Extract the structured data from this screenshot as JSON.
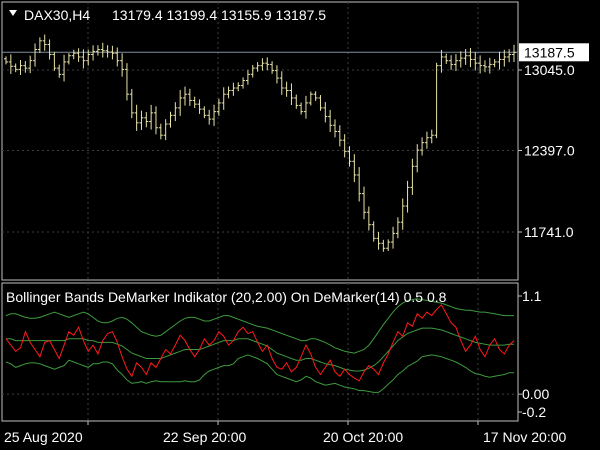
{
  "window": {
    "menu_icon": "triangle-down-icon",
    "symbol": "DAX30,H4",
    "ohlc": "13179.4 13199.4 13155.9 13187.5"
  },
  "main_chart": {
    "price_ticks": [
      {
        "label": "13045.0",
        "value": 13045.0
      },
      {
        "label": "12397.0",
        "value": 12397.0
      },
      {
        "label": "11741.0",
        "value": 11741.0
      }
    ],
    "last_price": {
      "label": "13187.5",
      "value": 13187.5
    },
    "colors": {
      "candle": "#e8e3a8",
      "grid": "#3a3f45",
      "border": "#bfbfbf",
      "price_line": "#7f8fa0"
    }
  },
  "indicator": {
    "title": "Bollinger Bands DeMarker Indikator (20,2.00) On DeMarker(14) 0.5 0.8",
    "ticks": [
      {
        "label": "1.1",
        "value": 1.1
      },
      {
        "label": "0.00",
        "value": 0.0
      },
      {
        "label": "-0.2",
        "value": -0.2
      }
    ],
    "colors": {
      "demarker": "#ff1a1a",
      "bands": "#3d9a3d"
    }
  },
  "time_axis": [
    {
      "label": "25 Aug 2020",
      "index": 0
    },
    {
      "label": "22 Sep 20:00",
      "index": 1
    },
    {
      "label": "20 Oct 20:00",
      "index": 2
    },
    {
      "label": "17 Nov 20:00",
      "index": 3
    }
  ],
  "chart_data": [
    {
      "type": "candlestick",
      "title": "DAX30,H4",
      "y_ticks": [
        13045.0,
        12397.0,
        11741.0
      ],
      "last_value": 13187.5,
      "open": 13179.4,
      "high": 13199.4,
      "low": 13155.9,
      "close": 13187.5,
      "closes": [
        13110,
        13075,
        13050,
        13080,
        13060,
        13120,
        13210,
        13280,
        13250,
        13170,
        13060,
        13010,
        13110,
        13160,
        13180,
        13150,
        13120,
        13170,
        13195,
        13210,
        13200,
        13190,
        13180,
        13120,
        13050,
        12850,
        12700,
        12620,
        12660,
        12630,
        12700,
        12580,
        12520,
        12610,
        12680,
        12740,
        12820,
        12850,
        12800,
        12770,
        12730,
        12680,
        12650,
        12710,
        12780,
        12850,
        12880,
        12900,
        12920,
        12960,
        13010,
        13060,
        13080,
        13100,
        13090,
        13040,
        12980,
        12900,
        12880,
        12820,
        12760,
        12710,
        12780,
        12850,
        12820,
        12740,
        12670,
        12600,
        12550,
        12480,
        12390,
        12310,
        12200,
        12050,
        11900,
        11800,
        11690,
        11650,
        11610,
        11660,
        11730,
        11820,
        11950,
        12100,
        12270,
        12400,
        12460,
        12500,
        12520,
        13080,
        13150,
        13120,
        13090,
        13120,
        13140,
        13160,
        13130,
        13100,
        13080,
        13070,
        13090,
        13110,
        13130,
        13150,
        13170,
        13187.5
      ]
    },
    {
      "type": "line",
      "title": "Bollinger Bands DeMarker Indikator (20,2.00) On DeMarker(14) 0.5 0.8",
      "y_ticks": [
        1.1,
        0.0,
        -0.2
      ],
      "ylim": [
        -0.2,
        1.1
      ],
      "series": [
        {
          "values": [
            0.62,
            0.55,
            0.48,
            0.52,
            0.7,
            0.58,
            0.5,
            0.42,
            0.58,
            0.6,
            0.5,
            0.4,
            0.55,
            0.7,
            0.66,
            0.75,
            0.6,
            0.48,
            0.55,
            0.45,
            0.6,
            0.68,
            0.7,
            0.58,
            0.42,
            0.28,
            0.2,
            0.35,
            0.3,
            0.22,
            0.35,
            0.3,
            0.4,
            0.5,
            0.45,
            0.55,
            0.66,
            0.6,
            0.5,
            0.42,
            0.5,
            0.62,
            0.55,
            0.6,
            0.7,
            0.65,
            0.55,
            0.6,
            0.7,
            0.75,
            0.68,
            0.7,
            0.58,
            0.48,
            0.55,
            0.4,
            0.3,
            0.28,
            0.35,
            0.25,
            0.3,
            0.42,
            0.55,
            0.45,
            0.3,
            0.22,
            0.3,
            0.38,
            0.25,
            0.2,
            0.28,
            0.22,
            0.18,
            0.15,
            0.25,
            0.32,
            0.28,
            0.22,
            0.35,
            0.45,
            0.58,
            0.7,
            0.65,
            0.8,
            0.76,
            0.9,
            0.85,
            0.92,
            0.88,
            0.95,
            1.0,
            0.9,
            0.8,
            0.75,
            0.6,
            0.48,
            0.55,
            0.65,
            0.5,
            0.42,
            0.55,
            0.62,
            0.5,
            0.45,
            0.55,
            0.6
          ]
        },
        {
          "values": [
            0.88,
            0.9,
            0.9,
            0.88,
            0.86,
            0.85,
            0.85,
            0.86,
            0.88,
            0.9,
            0.92,
            0.9,
            0.88,
            0.86,
            0.88,
            0.9,
            0.92,
            0.9,
            0.86,
            0.82,
            0.8,
            0.8,
            0.82,
            0.85,
            0.86,
            0.84,
            0.8,
            0.75,
            0.7,
            0.68,
            0.66,
            0.65,
            0.66,
            0.7,
            0.74,
            0.78,
            0.82,
            0.85,
            0.86,
            0.86,
            0.84,
            0.82,
            0.82,
            0.84,
            0.86,
            0.88,
            0.88,
            0.86,
            0.84,
            0.82,
            0.8,
            0.78,
            0.76,
            0.75,
            0.74,
            0.72,
            0.7,
            0.68,
            0.66,
            0.64,
            0.62,
            0.6,
            0.6,
            0.62,
            0.62,
            0.6,
            0.58,
            0.55,
            0.52,
            0.5,
            0.48,
            0.47,
            0.46,
            0.48,
            0.5,
            0.55,
            0.62,
            0.7,
            0.78,
            0.85,
            0.92,
            0.98,
            1.02,
            1.05,
            1.06,
            1.07,
            1.06,
            1.05,
            1.04,
            1.03,
            1.02,
            1.0,
            0.98,
            0.96,
            0.95,
            0.94,
            0.94,
            0.93,
            0.92,
            0.92,
            0.91,
            0.9,
            0.89,
            0.88,
            0.88,
            0.88
          ]
        },
        {
          "values": [
            0.62,
            0.62,
            0.6,
            0.6,
            0.6,
            0.6,
            0.6,
            0.6,
            0.6,
            0.6,
            0.6,
            0.6,
            0.6,
            0.62,
            0.62,
            0.62,
            0.62,
            0.6,
            0.6,
            0.58,
            0.58,
            0.58,
            0.58,
            0.56,
            0.54,
            0.5,
            0.46,
            0.44,
            0.42,
            0.4,
            0.4,
            0.4,
            0.4,
            0.42,
            0.44,
            0.46,
            0.48,
            0.5,
            0.5,
            0.5,
            0.5,
            0.52,
            0.54,
            0.56,
            0.58,
            0.6,
            0.6,
            0.6,
            0.62,
            0.62,
            0.62,
            0.6,
            0.58,
            0.56,
            0.54,
            0.5,
            0.46,
            0.44,
            0.42,
            0.4,
            0.38,
            0.38,
            0.4,
            0.4,
            0.38,
            0.36,
            0.34,
            0.33,
            0.32,
            0.3,
            0.28,
            0.27,
            0.26,
            0.26,
            0.27,
            0.29,
            0.32,
            0.36,
            0.42,
            0.48,
            0.54,
            0.6,
            0.64,
            0.68,
            0.7,
            0.72,
            0.74,
            0.74,
            0.74,
            0.73,
            0.72,
            0.7,
            0.68,
            0.66,
            0.64,
            0.62,
            0.6,
            0.58,
            0.57,
            0.56,
            0.55,
            0.55,
            0.55,
            0.55,
            0.56,
            0.56
          ]
        },
        {
          "values": [
            0.36,
            0.34,
            0.3,
            0.32,
            0.34,
            0.35,
            0.35,
            0.34,
            0.32,
            0.3,
            0.28,
            0.3,
            0.32,
            0.38,
            0.36,
            0.34,
            0.32,
            0.3,
            0.34,
            0.34,
            0.36,
            0.36,
            0.34,
            0.27,
            0.22,
            0.16,
            0.12,
            0.13,
            0.14,
            0.12,
            0.14,
            0.15,
            0.14,
            0.14,
            0.14,
            0.14,
            0.14,
            0.15,
            0.14,
            0.14,
            0.16,
            0.22,
            0.26,
            0.28,
            0.3,
            0.32,
            0.32,
            0.34,
            0.4,
            0.42,
            0.44,
            0.42,
            0.4,
            0.37,
            0.34,
            0.28,
            0.22,
            0.2,
            0.18,
            0.16,
            0.14,
            0.16,
            0.2,
            0.18,
            0.14,
            0.12,
            0.1,
            0.11,
            0.12,
            0.1,
            0.08,
            0.07,
            0.06,
            0.04,
            0.04,
            0.03,
            0.02,
            0.02,
            0.06,
            0.11,
            0.16,
            0.22,
            0.26,
            0.31,
            0.34,
            0.37,
            0.42,
            0.43,
            0.44,
            0.43,
            0.42,
            0.4,
            0.38,
            0.36,
            0.33,
            0.3,
            0.26,
            0.23,
            0.22,
            0.2,
            0.19,
            0.2,
            0.21,
            0.22,
            0.24,
            0.24
          ]
        }
      ]
    }
  ]
}
